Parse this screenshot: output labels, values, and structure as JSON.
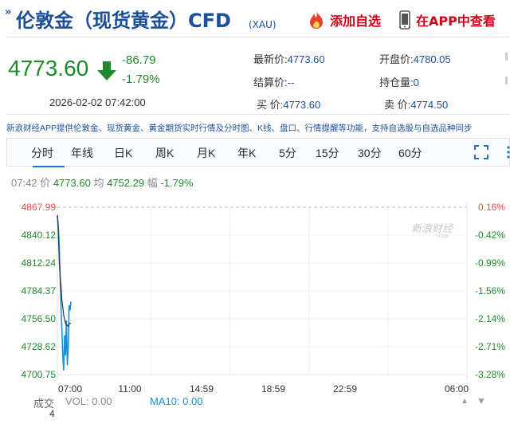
{
  "header": {
    "title_mark": "»",
    "title": "伦敦金（现货黄金）CFD",
    "title_sub": "(XAU)",
    "add_watch": "添加自选",
    "open_app": "在APP中查看"
  },
  "quote": {
    "price": "4773.60",
    "change": "-86.79",
    "change_pct": "-1.79%",
    "timestamp": "2026-02-02 07:42:00",
    "fields": {
      "latest_label": "最新价:",
      "latest_value": "4773.60",
      "open_label": "开盘价:",
      "open_value": "4780.05",
      "settle_label": "结算价:",
      "settle_value": "--",
      "oi_label": "持仓量:",
      "oi_value": "0",
      "bid_label": "买  价:",
      "bid_value": "4773.60",
      "ask_label": "卖  价:",
      "ask_value": "4774.50"
    }
  },
  "notice": "新浪财经APP提供伦敦金、现货黄金、黄金期货实时行情及分时图、K线、盘口、行情提醒等功能，支持自选股与自选品种同步",
  "tabs": [
    "分时",
    "年线",
    "日K",
    "周K",
    "月K",
    "年K",
    "5分",
    "15分",
    "30分",
    "60分"
  ],
  "info": {
    "time": "07:42",
    "price_label": "价",
    "price": "4773.60",
    "avg_label": "均",
    "avg": "4752.29",
    "amp_label": "幅",
    "amp": "-1.79%"
  },
  "watermark": "新浪财经",
  "watermark_sub": "sina",
  "colors": {
    "up": "#e8524e",
    "down": "#1f8a2c",
    "brand_blue": "#1b4f9b",
    "line": "#1b8fd6",
    "avg_line": "#333333"
  },
  "chart_data": {
    "type": "line",
    "y_ticks": [
      "4867.99",
      "4840.12",
      "4812.24",
      "4784.37",
      "4756.50",
      "4728.62",
      "4700.75"
    ],
    "pct_ticks": [
      "0.16%",
      "-0.42%",
      "-0.99%",
      "-1.56%",
      "-2.14%",
      "-2.71%",
      "-3.28%"
    ],
    "x_ticks": [
      "07:00",
      "11:00",
      "14:59",
      "18:59",
      "22:59",
      "06:00"
    ],
    "ylim": [
      4700.75,
      4867.99
    ],
    "prev_close": 4860.39,
    "series": [
      {
        "values": [
          4860,
          4850,
          4830,
          4800,
          4770,
          4745,
          4720,
          4705,
          4740,
          4720,
          4755,
          4710,
          4728,
          4770,
          4765,
          4773.6
        ]
      },
      {
        "values": [
          4860,
          4845,
          4815,
          4800,
          4790,
          4775,
          4768,
          4760,
          4756,
          4752,
          4750,
          4750,
          4749,
          4751,
          4752,
          4752.29
        ]
      }
    ]
  },
  "bottom": {
    "trade_label": "成交",
    "vol": "VOL: 0.00",
    "ma10": "MA10: 0.00",
    "count": "4"
  }
}
